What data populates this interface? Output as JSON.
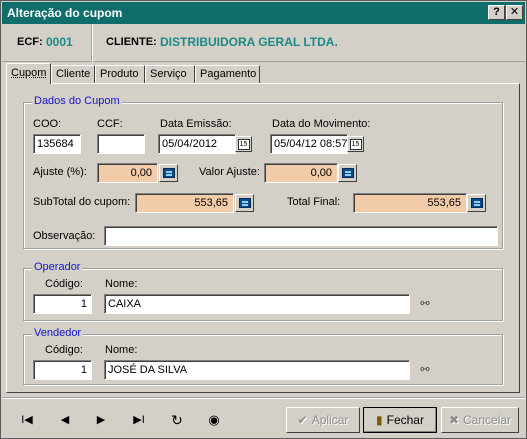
{
  "window": {
    "title": "Alteração do cupom",
    "help_glyph": "?",
    "close_glyph": "✕"
  },
  "header": {
    "ecf_label": "ECF:",
    "ecf_value": "0001",
    "cliente_label": "CLIENTE:",
    "cliente_value": "DISTRIBUIDORA GERAL LTDA."
  },
  "tabs": [
    {
      "label": "Cupom"
    },
    {
      "label": "Cliente"
    },
    {
      "label": "Produto"
    },
    {
      "label": "Serviço"
    },
    {
      "label": "Pagamento"
    }
  ],
  "dados_cupom": {
    "legend": "Dados do Cupom",
    "coo_label": "COO:",
    "coo_value": "135684",
    "ccf_label": "CCF:",
    "ccf_value": "",
    "data_emissao_label": "Data Emissão:",
    "data_emissao_value": "05/04/2012",
    "data_movimento_label": "Data do Movimento:",
    "data_movimento_value": "05/04/12 08:57",
    "ajuste_pct_label": "Ajuste (%):",
    "ajuste_pct_value": "0,00",
    "valor_ajuste_label": "Valor Ajuste:",
    "valor_ajuste_value": "0,00",
    "subtotal_label": "SubTotal do cupom:",
    "subtotal_value": "553,65",
    "total_final_label": "Total Final:",
    "total_final_value": "553,65",
    "observacao_label": "Observação:",
    "observacao_value": "",
    "date_button_glyph": "15"
  },
  "operador": {
    "legend": "Operador",
    "codigo_label": "Código:",
    "codigo_value": "1",
    "nome_label": "Nome:",
    "nome_value": "CAIXA"
  },
  "vendedor": {
    "legend": "Vendedor",
    "codigo_label": "Código:",
    "codigo_value": "1",
    "nome_label": "Nome:",
    "nome_value": "JOSÉ DA SILVA"
  },
  "navigation": {
    "first": "I◀",
    "prev": "◀",
    "next": "▶",
    "last": "▶I",
    "refresh": "↻",
    "record": "◉"
  },
  "buttons": {
    "aplicar": "Aplicar",
    "fechar": "Fechar",
    "cancelar": "Cancelar"
  },
  "colors": {
    "titlebar": "#0f6e6b",
    "accent_text": "#1a8a86",
    "legend": "#1515c8",
    "readonly_field": "#f2cba8"
  }
}
